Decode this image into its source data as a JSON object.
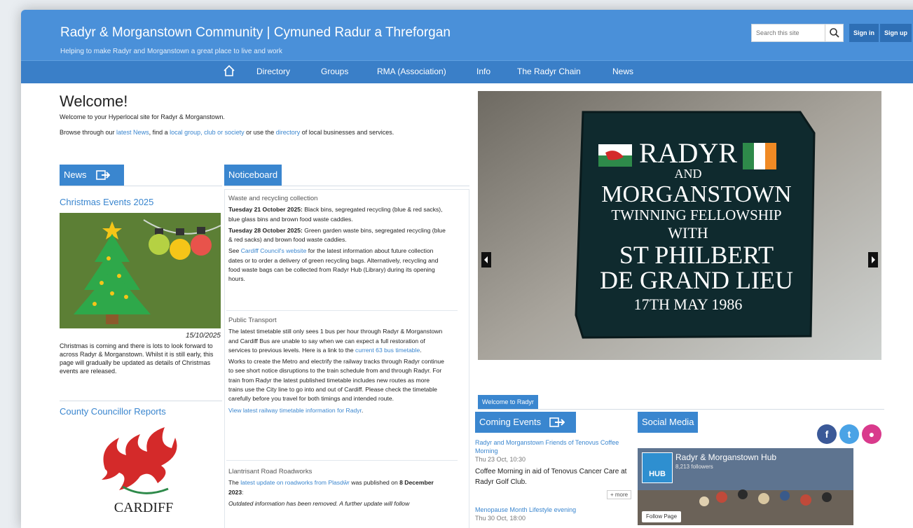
{
  "header": {
    "title": "Radyr & Morganstown Community | Cymuned Radur a Threforgan",
    "tagline": "Helping to make Radyr and Morganstown a great place to live and work",
    "search_placeholder": "Search this site",
    "sign_in": "Sign in",
    "sign_up": "Sign up"
  },
  "nav": {
    "items": [
      "Directory",
      "Groups",
      "RMA (Association)",
      "Info",
      "The Radyr Chain",
      "News"
    ]
  },
  "welcome": {
    "title": "Welcome!",
    "line1": "Welcome to your Hyperlocal site for Radyr & Morganstown.",
    "line2_a": "Browse through our ",
    "line2_link1": "latest News",
    "line2_b": ", find a ",
    "line2_link2": "local group, club or society",
    "line2_c": " or use the ",
    "line2_link3": "directory",
    "line2_d": " of local businesses and services."
  },
  "news": {
    "tab": "News",
    "headline": "Christmas Events 2025",
    "date": "15/10/2025",
    "summary": "Christmas is coming and there is lots to look forward to across Radyr & Morganstown. Whilst it is still early, this page will gradually be updated as details of Christmas events are released.",
    "ccr_title": "County Councillor Reports",
    "cardiff": "CARDIFF"
  },
  "noticeboard": {
    "tab": "Noticeboard",
    "waste": {
      "heading": "Waste and recycling collection",
      "p1_bold": "Tuesday 21 October 2025:",
      "p1": " Black bins, segregated recycling (blue & red sacks), blue glass bins and brown food waste caddies.",
      "p2_bold": "Tuesday 28 October 2025:",
      "p2": " Green garden waste bins, segregated recycling (blue & red sacks) and brown food waste caddies.",
      "p3_a": "See ",
      "p3_link": "Cardiff Council's website",
      "p3_b": " for the latest information about future collection dates or to order a delivery of green recycling bags. Alternatively, recycling and food waste bags can be collected from Radyr Hub (Library) during its opening hours."
    },
    "transport": {
      "heading": "Public Transport",
      "p1_a": "The latest timetable still only sees 1 bus per hour through Radyr & Morganstown and Cardiff Bus are unable to say when we can expect a full restoration of services to previous levels. Here is a link to the ",
      "p1_link": "current 63 bus timetable",
      "p1_b": ".",
      "p2": "Works to create the Metro and electrify the railway tracks through Radyr continue to see short notice disruptions to the train schedule from and through Radyr. For train from Radyr the latest published timetable includes new routes as more trains use the City line to go into and out of Cardiff. Please check the timetable carefully before you travel for both timings and intended route.",
      "p3_link": "View latest railway timetable information for Radyr",
      "p3_b": "."
    },
    "roadworks": {
      "heading": "Llantrisant Road Roadworks",
      "p1_a": "The ",
      "p1_link": "latest update on roadworks from Plasdŵr",
      "p1_b": " was published on ",
      "p1_bold": "8 December 2023",
      "p1_c": ":",
      "p2": "Outdated information has been removed. A further update will follow"
    }
  },
  "slideshow": {
    "plaque_lines": [
      "RADYR",
      "AND",
      "MORGANSTOWN",
      "TWINNING FELLOWSHIP",
      "WITH",
      "ST PHILBERT",
      "DE GRAND LIEU",
      "17TH MAY 1986"
    ]
  },
  "events": {
    "welcome_tab": "Welcome to Radyr",
    "tab": "Coming Events",
    "e1_title": "Radyr and Morganstown Friends of Tenovus Coffee Morning",
    "e1_date": "Thu 23 Oct, 10:30",
    "e1_desc": "Coffee Morning in aid of Tenovus Cancer Care at Radyr Golf Club.",
    "more": "+ more",
    "e2_title": "Menopause Month Lifestyle evening",
    "e2_date": "Thu 30 Oct, 18:00"
  },
  "social": {
    "tab": "Social Media",
    "page_name": "Radyr & Morganstown Hub",
    "followers": "8,213 followers",
    "hub": "HUB",
    "follow": "Follow Page"
  },
  "colors": {
    "brand_blue": "#4a90d9",
    "nav_blue": "#3a7fc8",
    "link_blue": "#3a86cf"
  }
}
